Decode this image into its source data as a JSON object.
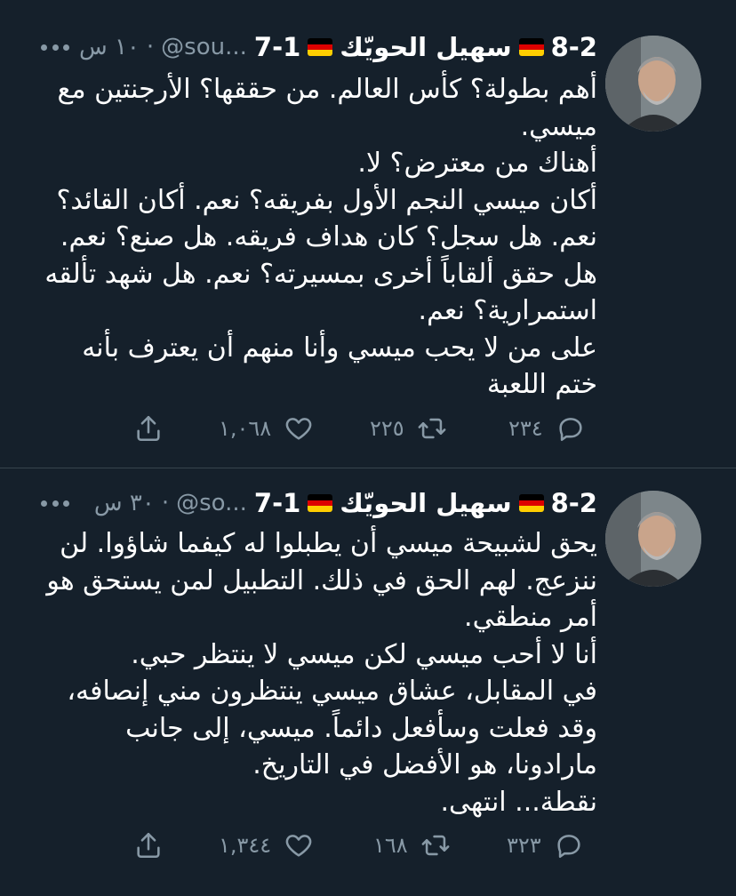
{
  "tweets": [
    {
      "author_name": "سهيل الحويّك",
      "score_left": "8-2",
      "score_right": "7-1",
      "handle": "@sou...",
      "separator": "·",
      "time": "١٠ س",
      "lines": [
        "أهم بطولة؟ كأس العالم. من حققها؟ الأرجنتين مع ميسي.",
        "أهناك من معترض؟ لا.",
        "أكان ميسي النجم الأول بفريقه؟ نعم. أكان القائد؟ نعم. هل سجل؟ كان هداف فريقه. هل صنع؟ نعم. هل حقق ألقاباً أخرى بمسيرته؟ نعم. هل شهد تألقه استمرارية؟ نعم.",
        "على من لا يحب ميسي وأنا منهم أن يعترف بأنه ختم اللعبة"
      ],
      "replies": "٢٣٤",
      "retweets": "٢٢٥",
      "likes": "١,٠٦٨"
    },
    {
      "author_name": "سهيل الحويّك",
      "score_left": "8-2",
      "score_right": "7-1",
      "handle": "@so...",
      "separator": "·",
      "time": "٣٠ س",
      "lines": [
        "يحق لشبيحة ميسي أن يطبلوا له كيفما شاؤوا. لن ننزعج. لهم الحق في ذلك. التطبيل لمن يستحق هو أمر منطقي.",
        "أنا لا أحب ميسي لكن ميسي لا ينتظر حبي.",
        "في المقابل، عشاق ميسي ينتظرون مني إنصافه، وقد فعلت وسأفعل دائماً. ميسي، إلى جانب مارادونا، هو الأفضل في التاريخ.",
        "نقطة... انتهى."
      ],
      "replies": "٣٢٣",
      "retweets": "١٦٨",
      "likes": "١,٣٤٤"
    }
  ],
  "colors": {
    "background": "#15202b",
    "divider": "#38444d",
    "text": "#ffffff",
    "muted": "#8899a6",
    "flag": [
      "#000000",
      "#dd0000",
      "#ffce00"
    ]
  },
  "icons": [
    "more-icon",
    "reply-icon",
    "retweet-icon",
    "like-icon",
    "share-icon",
    "germany-flag-icon"
  ]
}
